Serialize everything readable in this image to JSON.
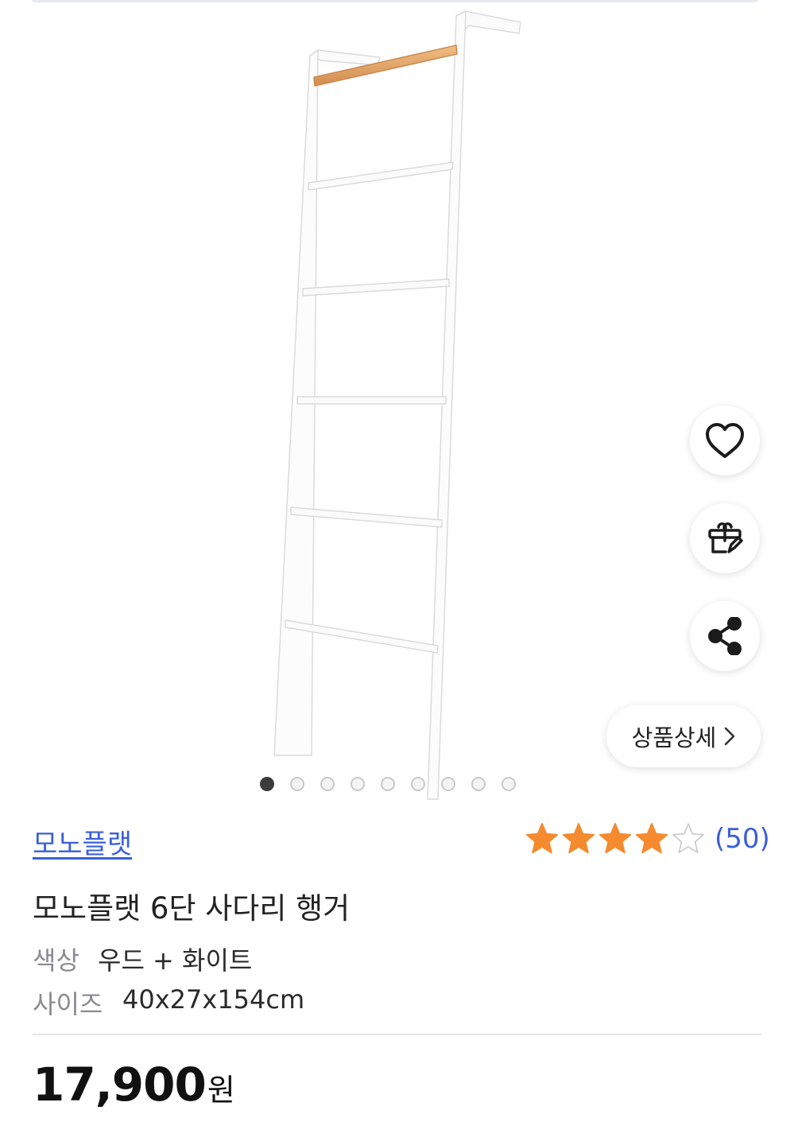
{
  "product": {
    "brand": "모노플랫",
    "title": "모노플랫 6단 사다리 행거",
    "rating": 4,
    "rating_max": 5,
    "review_count": "(50)",
    "specs": [
      {
        "label": "색상",
        "value": "우드 + 화이트"
      },
      {
        "label": "사이즈",
        "value": "40x27x154cm"
      }
    ],
    "price": "17,900",
    "price_unit": "원"
  },
  "actions": {
    "wishlist_icon": "heart-icon",
    "gift_icon": "gift-icon",
    "share_icon": "share-icon",
    "detail_label": "상품상세",
    "detail_chevron": "›"
  },
  "gallery": {
    "total_images": 9,
    "current_index": 1
  },
  "colors": {
    "accent_link": "#3a60d8",
    "star_filled": "#f58a2e",
    "star_empty": "#c8c8c8",
    "wood": "#e0a063"
  }
}
